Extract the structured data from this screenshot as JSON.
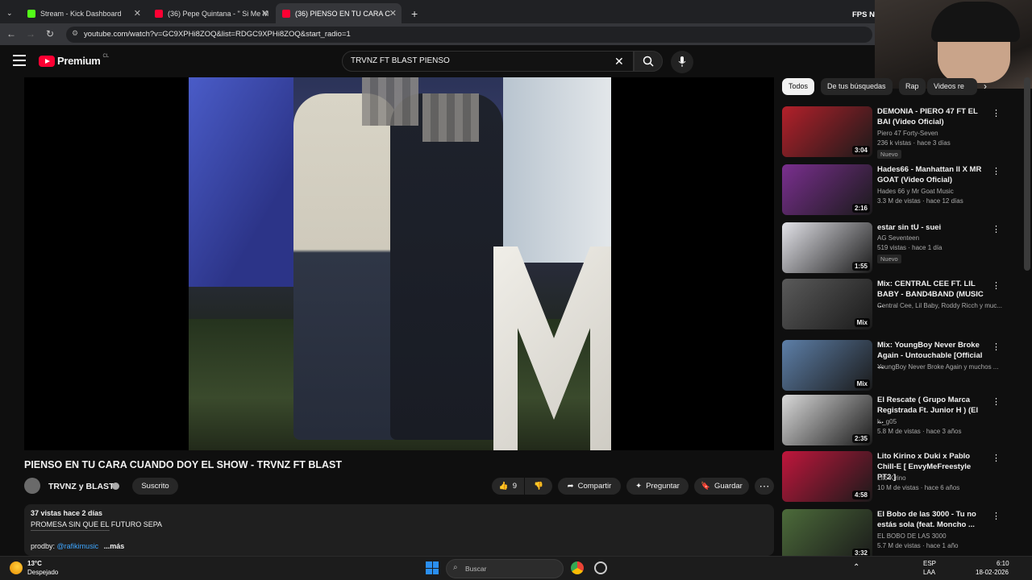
{
  "browser": {
    "tabs": [
      {
        "label": "Stream - Kick Dashboard",
        "color": "#53fc18"
      },
      {
        "label": "(36) Pepe Quintana - \" Si Me M",
        "color": "#ff0033"
      },
      {
        "label": "(36) PIENSO EN TU CARA C",
        "color": "#ff0033"
      }
    ],
    "url": "youtube.com/watch?v=GC9XPHi8ZOQ&list=RDGC9XPHi8ZOQ&start_radio=1",
    "fps_label": "FPS",
    "n_label": "N"
  },
  "header": {
    "logo": "Premium",
    "country": "CL",
    "search_value": "TRVNZ FT BLAST PIENSO"
  },
  "video": {
    "title": "PIENSO EN TU CARA CUANDO DOY EL SHOW - TRVNZ FT BLAST",
    "channel": "TRVNZ y BLAST",
    "subscribe": "Suscrito",
    "likes": "9",
    "share": "Compartir",
    "ask": "Preguntar",
    "save": "Guardar",
    "views_date": "37 vistas  hace 2 días",
    "desc_line1": "PROMESA SIN QUE EL FUTURO SEPA",
    "desc_divider": "-------------------------------------------------",
    "prodby_label": "prodby:",
    "prodby_link": "@rafikimusic",
    "more": "...más"
  },
  "chips": [
    "Todos",
    "De tus búsquedas",
    "Rap",
    "Videos re"
  ],
  "recommendations": [
    {
      "title": "DEMONIA - PIERO 47 FT EL BAI (Video Oficial)",
      "channel": "Piero 47 Forty-Seven",
      "meta": "236 k vistas · hace 3 días",
      "badge": "Nuevo",
      "duration": "3:04",
      "thumb": "#b3202a"
    },
    {
      "title": "Hades66 - Manhattan ll X MR GOAT (Video Oficial)",
      "channel": "Hades 66  y Mr Goat Music",
      "meta": "3.3 M de vistas · hace 12 días",
      "badge": "",
      "duration": "2:16",
      "thumb": "#7a2f8f"
    },
    {
      "title": "estar sin tU - suei",
      "channel": "AG Seventeen",
      "meta": "519 vistas · hace 1 día",
      "badge": "Nuevo",
      "duration": "1:55",
      "thumb": "#e2e2e8"
    },
    {
      "title": "Mix: CENTRAL CEE FT. LIL BABY - BAND4BAND (MUSIC ...",
      "channel": "Central Cee, Lil Baby, Roddy Ricch y muc...",
      "meta": "",
      "badge": "",
      "duration": "Mix",
      "thumb": "#5a5a5a"
    },
    {
      "title": "Mix: YoungBoy Never Broke Again - Untouchable [Official ...",
      "channel": "YoungBoy Never Broke Again y muchos ...",
      "meta": "",
      "badge": "",
      "duration": "Mix",
      "thumb": "#5d7fa8"
    },
    {
      "title": "El Rescate ( Grupo Marca Registrada Ft. Junior H ) (El ...",
      "channel": "k._g05",
      "meta": "5.8 M de vistas · hace 3 años",
      "badge": "",
      "duration": "2:35",
      "thumb": "#d9d9d9"
    },
    {
      "title": "Lito Kirino x Duki x Pablo Chill-E [ EnvyMeFreestyle PT2 ]",
      "channel": "Lito Kirino",
      "meta": "10 M de vistas · hace 6 años",
      "badge": "",
      "duration": "4:58",
      "thumb": "#c0163c"
    },
    {
      "title": "El Bobo de las 3000 - Tu no estás sola (feat. Moncho ...",
      "channel": "EL BOBO DE LAS 3000",
      "meta": "5.7 M de vistas · hace 1 año",
      "badge": "",
      "duration": "3:32",
      "thumb": "#4c6b3a"
    }
  ],
  "taskbar": {
    "temp": "13°C",
    "weather": "Despejado",
    "search": "Buscar",
    "lang1": "ESP",
    "lang2": "LAA",
    "time": "6:10",
    "date": "18-02-2026"
  }
}
